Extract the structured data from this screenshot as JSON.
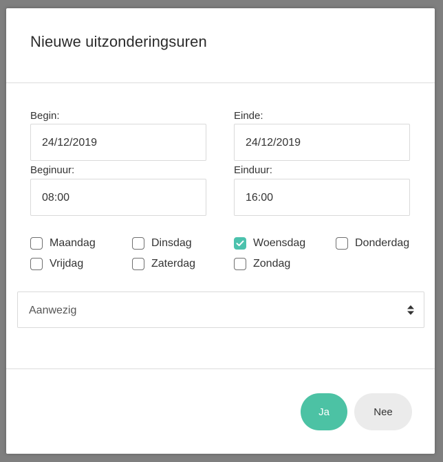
{
  "modal": {
    "title": "Nieuwe uitzonderingsuren"
  },
  "form": {
    "begin_label": "Begin:",
    "begin_value": "24/12/2019",
    "end_label": "Einde:",
    "end_value": "24/12/2019",
    "begin_hour_label": "Beginuur:",
    "begin_hour_value": "08:00",
    "end_hour_label": "Einduur:",
    "end_hour_value": "16:00"
  },
  "days": [
    {
      "label": "Maandag",
      "checked": false
    },
    {
      "label": "Dinsdag",
      "checked": false
    },
    {
      "label": "Woensdag",
      "checked": true
    },
    {
      "label": "Donderdag",
      "checked": false
    },
    {
      "label": "Vrijdag",
      "checked": false
    },
    {
      "label": "Zaterdag",
      "checked": false
    },
    {
      "label": "Zondag",
      "checked": false
    }
  ],
  "status_select": {
    "selected": "Aanwezig",
    "icon": "sort-arrows-icon"
  },
  "buttons": {
    "yes_label": "Ja",
    "no_label": "Nee"
  },
  "colors": {
    "accent": "#4cc2a4",
    "checkbox_checked": "#4cc2ad",
    "secondary_button": "#ebebeb"
  }
}
